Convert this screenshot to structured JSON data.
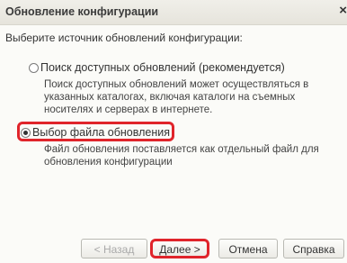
{
  "window": {
    "title": "Обновление конфигурации",
    "close_icon": "×"
  },
  "prompt": "Выберите источник обновлений конфигурации:",
  "options": [
    {
      "label": "Поиск доступных обновлений (рекомендуется)",
      "checked": false,
      "description": [
        "Поиск доступных обновлений может осуществляться в",
        "указанных каталогах, включая каталоги на съемных",
        "носителях и серверах в интернете."
      ]
    },
    {
      "label": "Выбор файла обновления",
      "checked": true,
      "description": [
        "Файл обновления поставляется как отдельный файл для",
        "обновления конфигурации"
      ]
    }
  ],
  "buttons": {
    "back": "< Назад",
    "next": "Далее >",
    "cancel": "Отмена",
    "help": "Справка"
  },
  "colors": {
    "highlight": "#e0242b"
  }
}
